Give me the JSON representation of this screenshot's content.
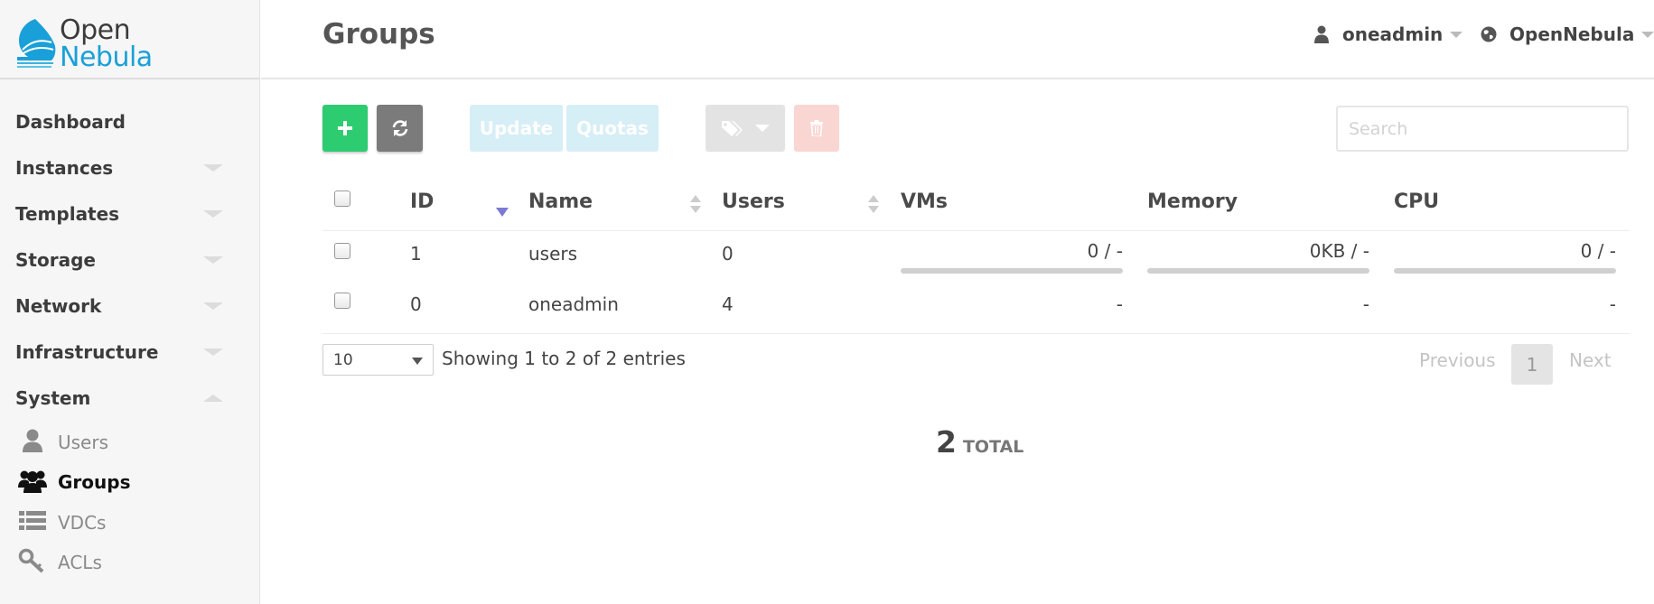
{
  "app": {
    "logo_line1": "Open",
    "logo_line2": "Nebula"
  },
  "sidebar": {
    "items": [
      {
        "label": "Dashboard",
        "caret": "none"
      },
      {
        "label": "Instances",
        "caret": "down"
      },
      {
        "label": "Templates",
        "caret": "down"
      },
      {
        "label": "Storage",
        "caret": "down"
      },
      {
        "label": "Network",
        "caret": "down"
      },
      {
        "label": "Infrastructure",
        "caret": "down"
      },
      {
        "label": "System",
        "caret": "up"
      }
    ],
    "sub_items": [
      {
        "label": "Users",
        "icon": "user-icon",
        "active": false
      },
      {
        "label": "Groups",
        "icon": "users-group-icon",
        "active": true
      },
      {
        "label": "VDCs",
        "icon": "list-icon",
        "active": false
      },
      {
        "label": "ACLs",
        "icon": "key-icon",
        "active": false
      }
    ]
  },
  "header": {
    "title": "Groups",
    "user_menu": {
      "label": "oneadmin",
      "icon": "user-icon"
    },
    "zone_menu": {
      "label": "OpenNebula",
      "icon": "globe-icon"
    }
  },
  "toolbar": {
    "create_icon": "plus-icon",
    "refresh_icon": "refresh-icon",
    "update_label": "Update",
    "quotas_label": "Quotas",
    "labels_icon": "tags-icon",
    "delete_icon": "trash-icon",
    "search_placeholder": "Search"
  },
  "table": {
    "columns": [
      "ID",
      "Name",
      "Users",
      "VMs",
      "Memory",
      "CPU"
    ],
    "sort": {
      "column": "ID",
      "direction": "desc"
    },
    "rows": [
      {
        "id": "1",
        "name": "users",
        "users": "0",
        "vms": "0 / -",
        "memory": "0KB / -",
        "cpu": "0 / -",
        "bars": true
      },
      {
        "id": "0",
        "name": "oneadmin",
        "users": "4",
        "vms": "-",
        "memory": "-",
        "cpu": "-",
        "bars": false
      }
    ]
  },
  "footer": {
    "page_length": "10",
    "showing": "Showing 1 to 2 of 2 entries",
    "previous": "Previous",
    "current_page": "1",
    "next": "Next"
  },
  "summary": {
    "total_count": "2",
    "total_label": "TOTAL"
  },
  "colors": {
    "create": "#2ecc71",
    "refresh": "#7b7b7b",
    "brand_blue": "#1aa0d8",
    "update_disabled": "#d6eef5",
    "delete_disabled": "#fad6d2"
  }
}
